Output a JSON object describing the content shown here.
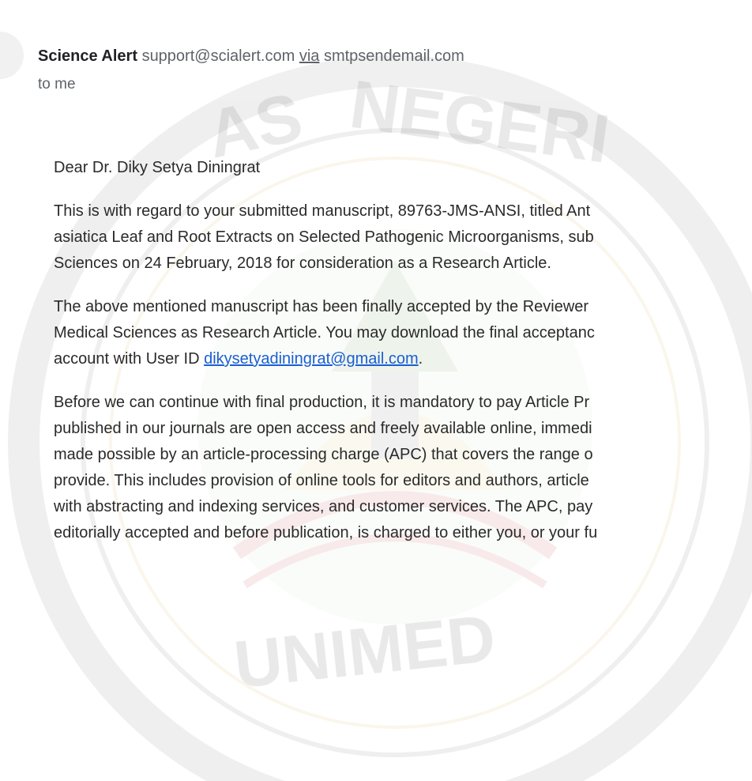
{
  "email": {
    "sender_name": "Science Alert",
    "sender_address": "support@scialert.com",
    "via_label": "via",
    "via_domain": "smtpsendemail.com",
    "recipient": "to me"
  },
  "watermark": {
    "top_text": "NEGERI",
    "left_text": "AS",
    "bottom_text": "UNIMED"
  },
  "body": {
    "greeting": "Dear Dr. Diky Setya Diningrat",
    "para1": [
      "This is with regard to your submitted manuscript, 89763-JMS-ANSI, titled Ant",
      "asiatica Leaf and Root Extracts on Selected Pathogenic Microorganisms, sub",
      "Sciences on 24 February, 2018 for consideration as a Research Article."
    ],
    "para2_line1": "The above mentioned manuscript has been finally accepted by the Reviewer",
    "para2_line2": "Medical Sciences as Research Article. You may download the final acceptanc",
    "para2_line3_prefix": "account with User ID ",
    "para2_link": "dikysetyadiningrat@gmail.com",
    "para2_line3_suffix": ".",
    "para3": [
      "Before we can continue with final production, it is mandatory to pay Article Pr",
      "published in our journals are open access and freely available online, immedi",
      "made possible by an article-processing charge (APC) that covers the range o",
      "provide. This includes provision of online tools for editors and authors, article",
      "with abstracting and indexing services, and customer services. The APC, pay",
      "editorially accepted and before publication, is charged to either you, or your fu"
    ]
  }
}
